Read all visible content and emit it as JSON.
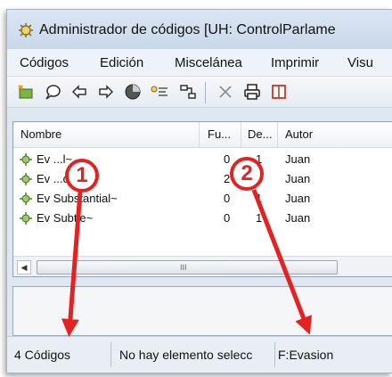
{
  "window": {
    "title": "Administrador de códigos [UH: ControlParlame",
    "icon": "code-manager-icon"
  },
  "menu": [
    "Códigos",
    "Edición",
    "Miscelánea",
    "Imprimir",
    "Visu"
  ],
  "toolbar": {
    "buttons": [
      "new-code-icon",
      "comment-icon",
      "arrow-left-icon",
      "arrow-right-icon",
      "color-circle-icon",
      "code-tree-icon",
      "network-icon",
      "delete-icon",
      "print-icon",
      "view-panel-icon"
    ]
  },
  "table": {
    "headers": [
      "Nombre",
      "Fu...",
      "De...",
      "Autor"
    ],
    "rows": [
      {
        "name": "Ev ...l~",
        "fu": "0",
        "de": "1",
        "author": "Juan"
      },
      {
        "name": "Ev ...dium~",
        "fu": "2",
        "de": "1",
        "author": "Juan"
      },
      {
        "name": "Ev Substantial~",
        "fu": "0",
        "de": "1",
        "author": "Juan"
      },
      {
        "name": "Ev Subtle~",
        "fu": "0",
        "de": "1",
        "author": "Juan"
      }
    ],
    "scroll_grip": "III"
  },
  "status": {
    "count": "4 Códigos",
    "selection": "No hay elemento selecc",
    "family": "F:Evasion"
  },
  "annotations": {
    "badge1": "1",
    "badge2": "2",
    "accent_color": "#e32222"
  }
}
